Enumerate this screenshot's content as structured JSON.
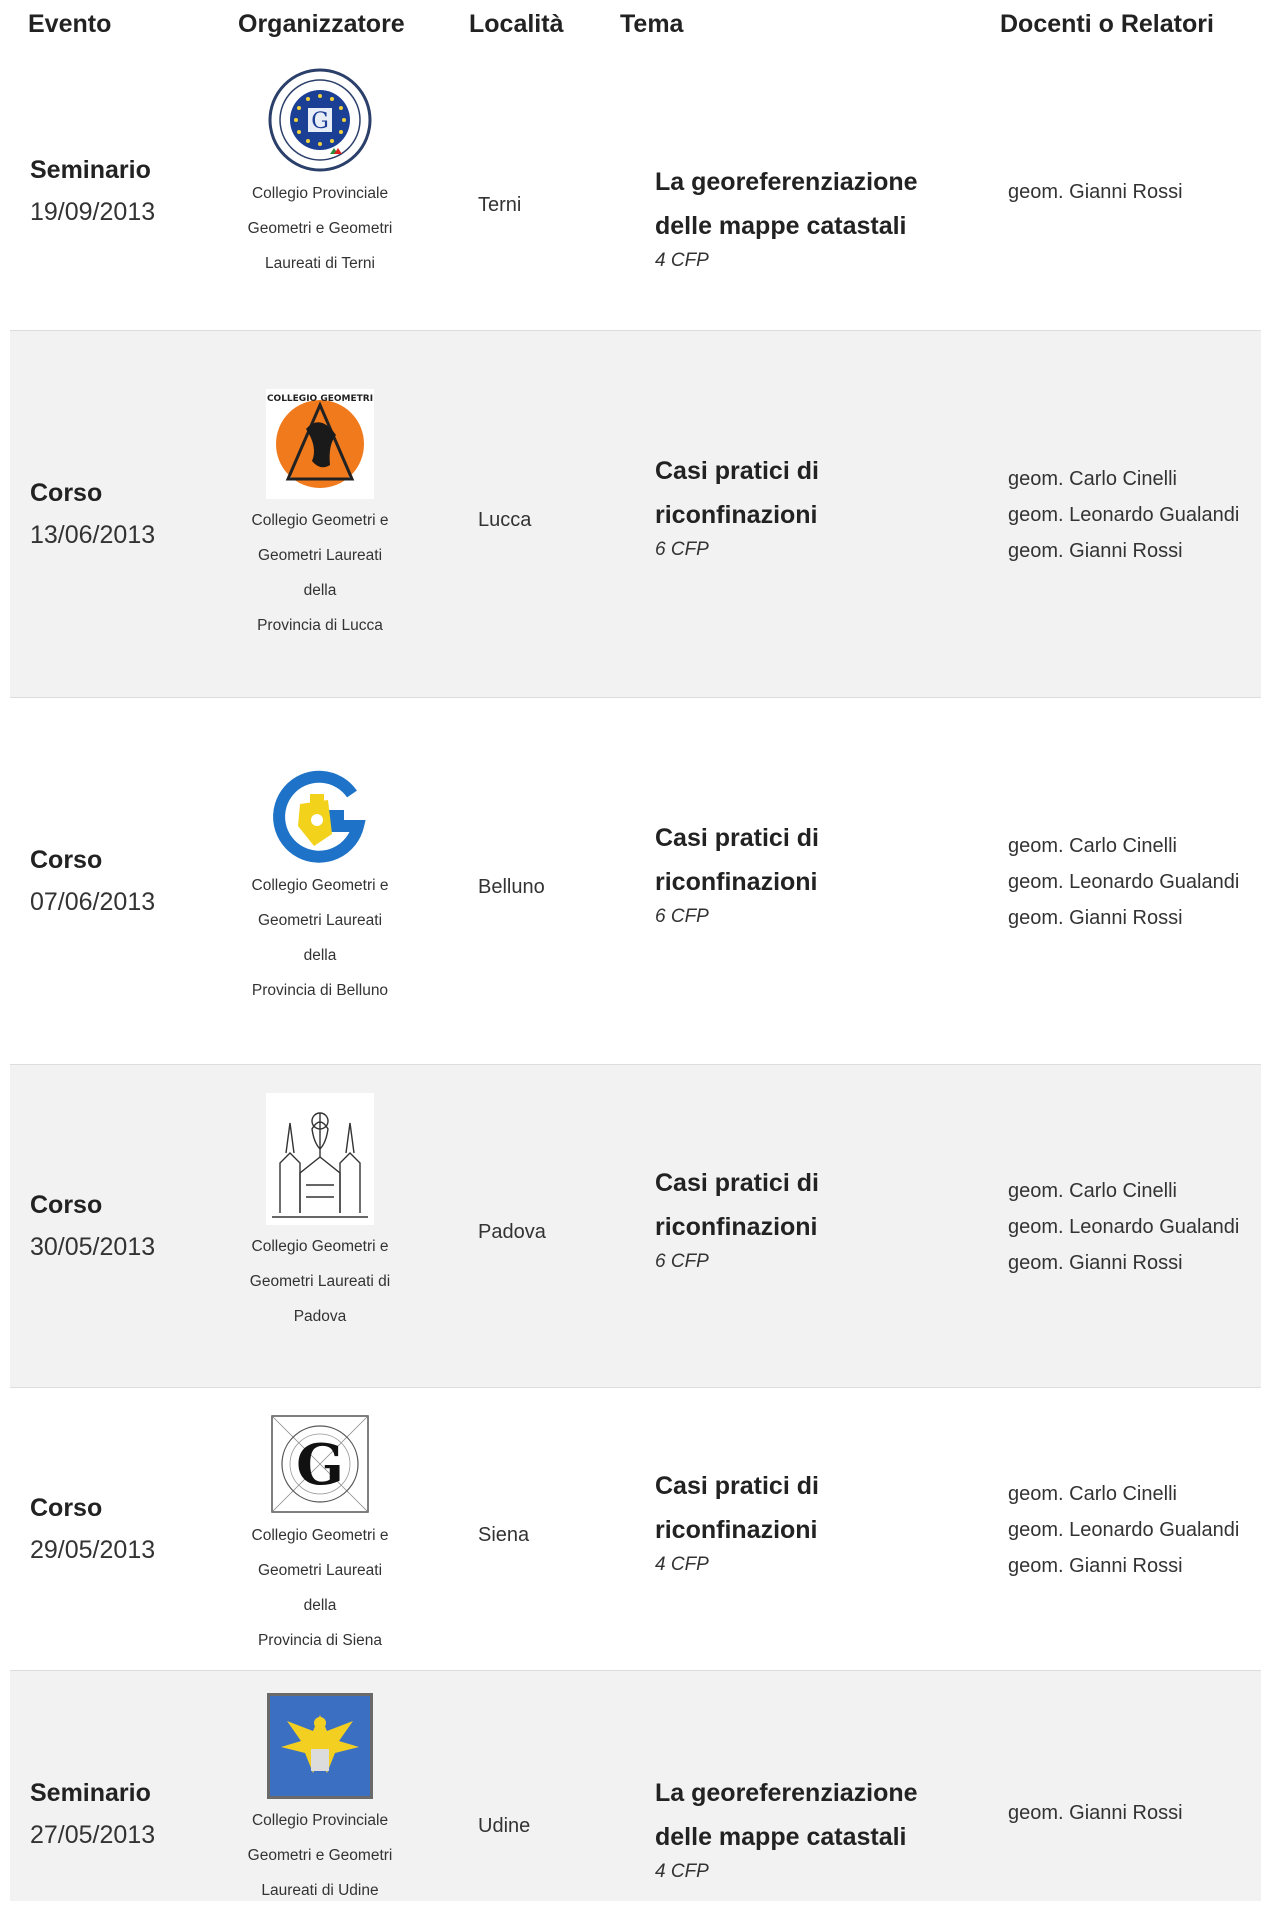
{
  "headers": {
    "evento": "Evento",
    "organizzatore": "Organizzatore",
    "localita": "Località",
    "tema": "Tema",
    "docenti": "Docenti o Relatori"
  },
  "rows": [
    {
      "type": "Seminario",
      "date": "19/09/2013",
      "org_lines": [
        "Collegio Provinciale",
        "Geometri e Geometri",
        "Laureati di Terni"
      ],
      "logo": "terni-collegio-logo",
      "localita": "Terni",
      "tema_lines": [
        "La georeferenziazione",
        "delle mappe catastali"
      ],
      "cfp": "4 CFP",
      "docenti": [
        "geom. Gianni Rossi"
      ]
    },
    {
      "type": "Corso",
      "date": "13/06/2013",
      "org_lines": [
        "Collegio Geometri e",
        "Geometri Laureati della",
        "Provincia di Lucca"
      ],
      "logo": "lucca-collegio-logo",
      "localita": "Lucca",
      "tema_lines": [
        "Casi pratici di",
        "riconfinazioni"
      ],
      "cfp": "6 CFP",
      "docenti": [
        "geom. Carlo Cinelli",
        "geom. Leonardo Gualandi",
        "geom. Gianni Rossi"
      ]
    },
    {
      "type": "Corso",
      "date": "07/06/2013",
      "org_lines": [
        "Collegio Geometri e",
        "Geometri Laureati della",
        "Provincia di Belluno"
      ],
      "logo": "belluno-collegio-logo",
      "localita": "Belluno",
      "tema_lines": [
        "Casi pratici di",
        "riconfinazioni"
      ],
      "cfp": "6 CFP",
      "docenti": [
        "geom. Carlo Cinelli",
        "geom. Leonardo Gualandi",
        "geom. Gianni Rossi"
      ]
    },
    {
      "type": "Corso",
      "date": "30/05/2013",
      "org_lines": [
        "Collegio Geometri e",
        "Geometri Laureati di",
        "Padova"
      ],
      "logo": "padova-collegio-logo",
      "localita": "Padova",
      "tema_lines": [
        "Casi pratici di",
        "riconfinazioni"
      ],
      "cfp": "6 CFP",
      "docenti": [
        "geom. Carlo Cinelli",
        "geom. Leonardo Gualandi",
        "geom. Gianni Rossi"
      ]
    },
    {
      "type": "Corso",
      "date": "29/05/2013",
      "org_lines": [
        "Collegio Geometri e",
        "Geometri Laureati della",
        "Provincia di Siena"
      ],
      "logo": "siena-collegio-logo",
      "localita": "Siena",
      "tema_lines": [
        "Casi pratici di",
        "riconfinazioni"
      ],
      "cfp": "4 CFP",
      "docenti": [
        "geom. Carlo Cinelli",
        "geom. Leonardo Gualandi",
        "geom. Gianni Rossi"
      ]
    },
    {
      "type": "Seminario",
      "date": "27/05/2013",
      "org_lines": [
        "Collegio Provinciale",
        "Geometri e Geometri",
        "Laureati di Udine"
      ],
      "logo": "udine-collegio-logo",
      "localita": "Udine",
      "tema_lines": [
        "La georeferenziazione",
        "delle mappe catastali"
      ],
      "cfp": "4 CFP",
      "docenti": [
        "geom. Gianni Rossi"
      ]
    }
  ]
}
